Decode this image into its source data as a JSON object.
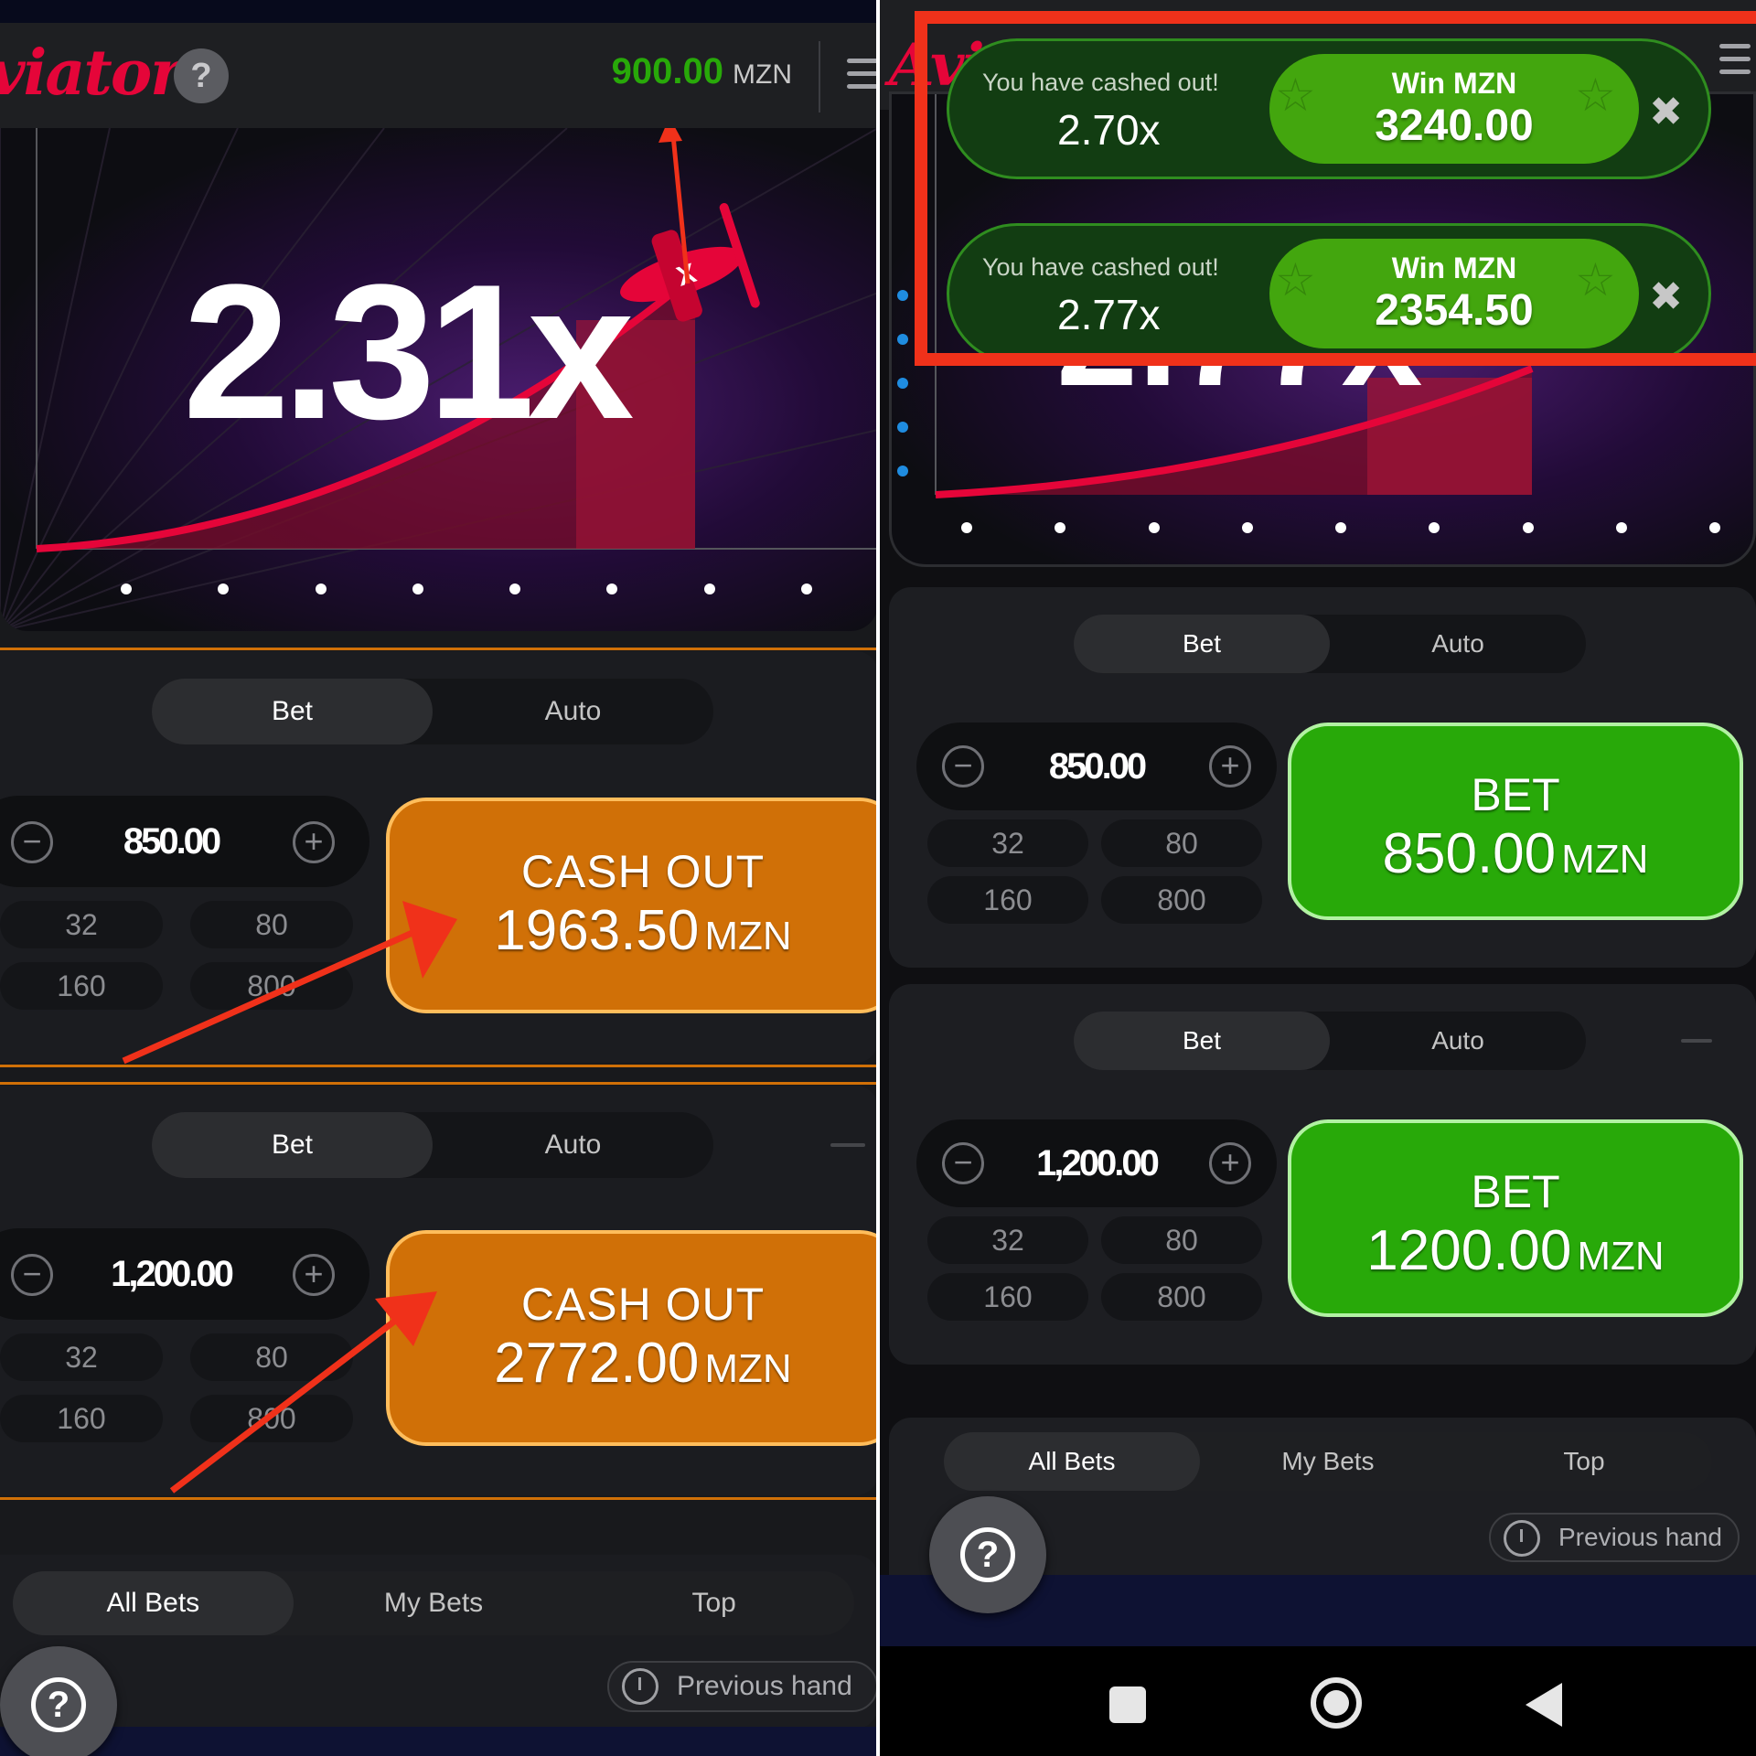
{
  "left": {
    "header": {
      "logo": "viator",
      "help": "?",
      "balance_amount": "900.00",
      "balance_currency": "MZN"
    },
    "game": {
      "multiplier": "2.31x"
    },
    "bet_panels": [
      {
        "tabs": [
          "Bet",
          "Auto"
        ],
        "stake": "850.00",
        "chips": [
          "32",
          "80",
          "160",
          "800"
        ],
        "button_line1": "CASH OUT",
        "button_amount": "1963.50",
        "button_currency": "MZN"
      },
      {
        "tabs": [
          "Bet",
          "Auto"
        ],
        "stake": "1,200.00",
        "chips": [
          "32",
          "80",
          "160",
          "800"
        ],
        "button_line1": "CASH OUT",
        "button_amount": "2772.00",
        "button_currency": "MZN"
      }
    ],
    "list_tabs": [
      "All Bets",
      "My Bets",
      "Top"
    ],
    "previous_hand": "Previous hand",
    "help": "?"
  },
  "right": {
    "header": {
      "logo": "Avi"
    },
    "toasts": [
      {
        "message": "You have cashed out!",
        "multiplier": "2.70x",
        "win_label": "Win MZN",
        "win_amount": "3240.00",
        "close": "✖"
      },
      {
        "message": "You have cashed out!",
        "multiplier": "2.77x",
        "win_label": "Win MZN",
        "win_amount": "2354.50",
        "close": "✖"
      }
    ],
    "bet_panels": [
      {
        "tabs": [
          "Bet",
          "Auto"
        ],
        "stake": "850.00",
        "chips": [
          "32",
          "80",
          "160",
          "800"
        ],
        "button_line1": "BET",
        "button_amount": "850.00",
        "button_currency": "MZN"
      },
      {
        "tabs": [
          "Bet",
          "Auto"
        ],
        "stake": "1,200.00",
        "chips": [
          "32",
          "80",
          "160",
          "800"
        ],
        "button_line1": "BET",
        "button_amount": "1200.00",
        "button_currency": "MZN"
      }
    ],
    "list_tabs": [
      "All Bets",
      "My Bets",
      "Top"
    ],
    "previous_hand": "Previous hand",
    "help": "?"
  },
  "colors": {
    "accent_red": "#e50539",
    "win_green": "#28a909",
    "cashout_orange": "#d07007",
    "annotation_red": "#f0311a"
  }
}
